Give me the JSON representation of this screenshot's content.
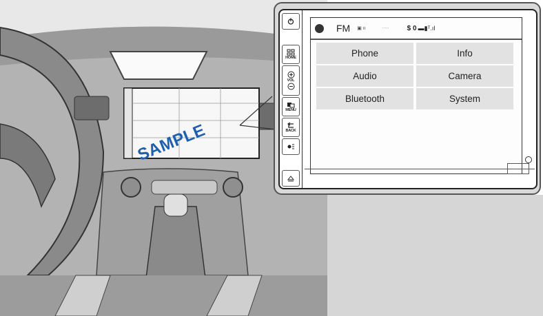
{
  "watermark": "SAMPLE",
  "side_buttons": [
    {
      "key": "power",
      "label": "",
      "icon": "power-icon"
    },
    {
      "key": "home",
      "label": "HOME",
      "icon": "home-icon"
    },
    {
      "key": "vol",
      "label": "VOL",
      "icon": "volume-icon"
    },
    {
      "key": "menu",
      "label": "MENU",
      "icon": "menu-icon"
    },
    {
      "key": "back",
      "label": "BACK",
      "icon": "back-icon"
    },
    {
      "key": "brightness",
      "label": "",
      "icon": "brightness-icon"
    },
    {
      "key": "eject",
      "label": "",
      "icon": "eject-icon"
    }
  ],
  "status_bar": {
    "source": "FM",
    "icons": [
      "audio-icon",
      "signal-icon",
      "phone-icon",
      "battery-icon"
    ]
  },
  "menu_items": [
    {
      "label": "Phone"
    },
    {
      "label": "Info"
    },
    {
      "label": "Audio"
    },
    {
      "label": "Camera"
    },
    {
      "label": "Bluetooth"
    },
    {
      "label": "System"
    }
  ]
}
